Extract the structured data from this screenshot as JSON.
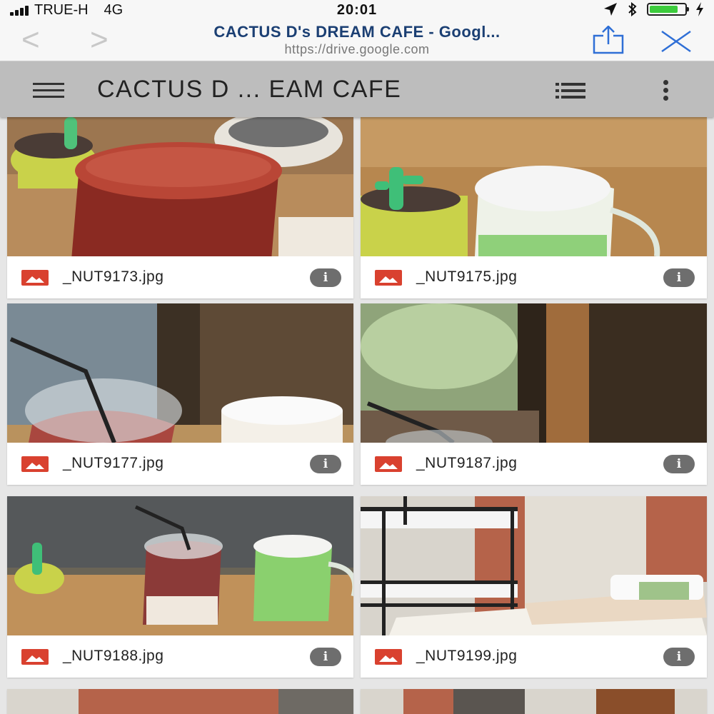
{
  "status_bar": {
    "carrier": "TRUE-H",
    "network": "4G",
    "time": "20:01",
    "battery_level": 0.82,
    "icons": [
      "signal-icon",
      "location-arrow-icon",
      "bluetooth-icon",
      "battery-icon",
      "charging-bolt-icon"
    ]
  },
  "browser": {
    "page_title": "CACTUS D's DREAM CAFE - Googl...",
    "url": "https://drive.google.com",
    "back_glyph": "<",
    "forward_glyph": ">"
  },
  "drive": {
    "folder_title": "CACTUS D ... EAM CAFE",
    "colors": {
      "app_bar": "#bdbdbd",
      "image_icon": "#d9412f",
      "info_icon": "#6e6e6e"
    }
  },
  "files": [
    {
      "name": "_NUT9173.jpg",
      "info": "i"
    },
    {
      "name": "_NUT9175.jpg",
      "info": "i"
    },
    {
      "name": "_NUT9177.jpg",
      "info": "i"
    },
    {
      "name": "_NUT9187.jpg",
      "info": "i"
    },
    {
      "name": "_NUT9188.jpg",
      "info": "i"
    },
    {
      "name": "_NUT9199.jpg",
      "info": "i"
    }
  ]
}
